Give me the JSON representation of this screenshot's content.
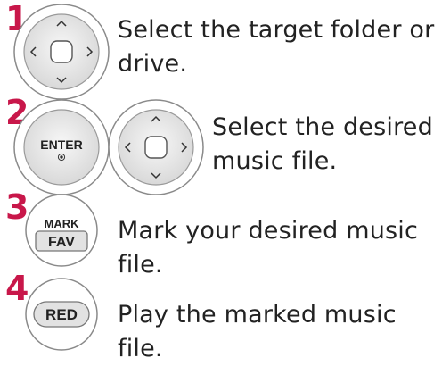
{
  "steps": [
    {
      "number": "1",
      "buttons": [
        "navigation-pad"
      ],
      "text_line1": "Select the target folder or",
      "text_line2": "drive."
    },
    {
      "number": "2",
      "buttons": [
        "enter-button",
        "navigation-pad"
      ],
      "enter_label": "ENTER",
      "text_line1": "Select the desired",
      "text_line2": "music file."
    },
    {
      "number": "3",
      "buttons": [
        "fav-button"
      ],
      "mark_label": "MARK",
      "fav_label": "FAV",
      "text": "Mark your desired music file."
    },
    {
      "number": "4",
      "buttons": [
        "red-button"
      ],
      "red_label": "RED",
      "text": "Play the marked music file."
    }
  ],
  "colors": {
    "step_number": "#c8174a",
    "button_fill": "#e9e9e9",
    "button_stroke": "#888888"
  }
}
